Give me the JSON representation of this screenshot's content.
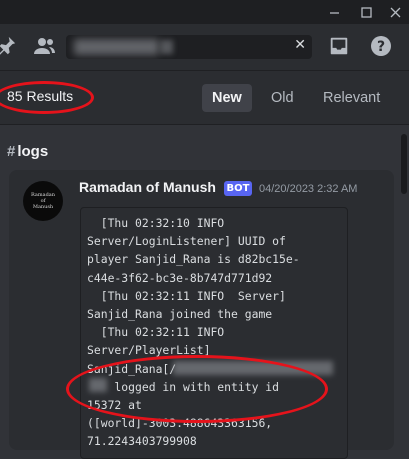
{
  "window": {
    "minimize_icon": "minimize-icon",
    "maximize_icon": "maximize-icon",
    "close_icon": "close-icon"
  },
  "toolbar": {
    "icons": [
      "pin-icon",
      "members-icon",
      "inbox-icon",
      "help-icon"
    ],
    "search": {
      "clear_symbol": "✕"
    }
  },
  "results": {
    "count_label": "85 Results",
    "sort_tabs": [
      {
        "label": "New",
        "active": true
      },
      {
        "label": "Old",
        "active": false
      },
      {
        "label": "Relevant",
        "active": false
      }
    ]
  },
  "channel": {
    "hash": "#",
    "name": "logs"
  },
  "message": {
    "avatar_text": [
      "Ramadan",
      "of",
      "Manush"
    ],
    "author": "Ramadan of Manush",
    "badge": "BOT",
    "timestamp": "04/20/2023 2:32 AM",
    "code_text": "  [Thu 02:32:10 INFO\nServer/LoginListener] UUID of\nplayer Sanjid_Rana is d82bc15e-\nc44e-3f62-bc3e-8b747d771d92\n  [Thu 02:32:11 INFO  Server]\nSanjid_Rana joined the game\n  [Thu 02:32:11 INFO\nServer/PlayerList]\nSanjid_Rana[/\n    logged in with entity id\n15372 at\n([world]-3003.488643363156,\n71.2243403799908"
  },
  "colors": {
    "background": "#313338",
    "panel": "#2b2d31",
    "accent": "#5865f2",
    "annotation_red": "#e5131b"
  }
}
